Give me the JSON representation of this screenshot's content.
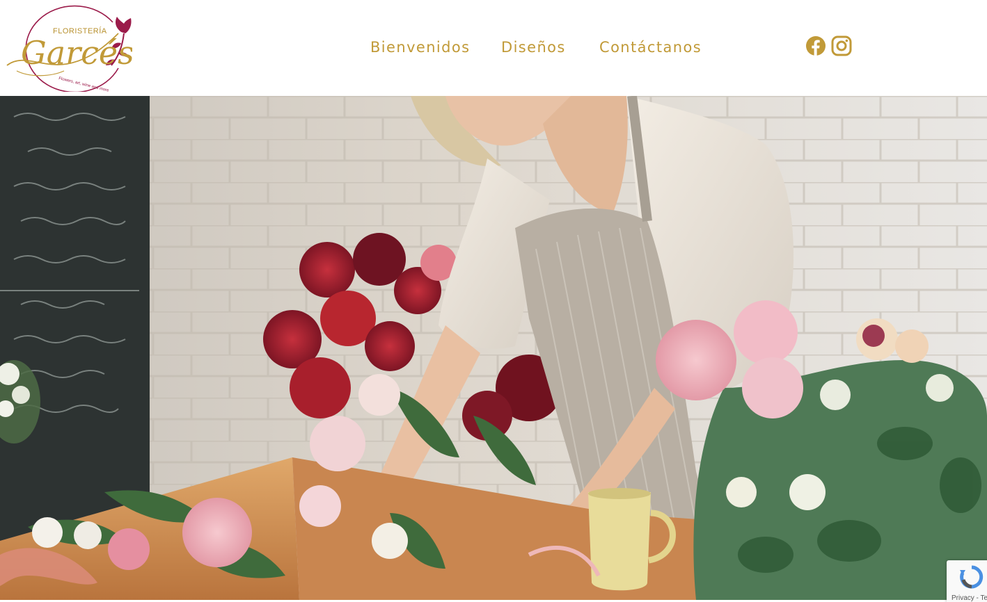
{
  "logo": {
    "brand_top": "FLORISTERÍA",
    "brand_name": "Garcés",
    "tagline": "Flowers, art, wine and more"
  },
  "nav": {
    "items": [
      {
        "label": "Bienvenidos"
      },
      {
        "label": "Diseños"
      },
      {
        "label": "Contáctanos"
      }
    ]
  },
  "social": {
    "facebook_icon": "facebook-icon",
    "instagram_icon": "instagram-icon"
  },
  "recaptcha": {
    "label": "Privacy - Terms",
    "icon": "recaptcha-icon"
  },
  "colors": {
    "brand_gold": "#c19a38",
    "accent_burgundy": "#9b1b4a"
  }
}
